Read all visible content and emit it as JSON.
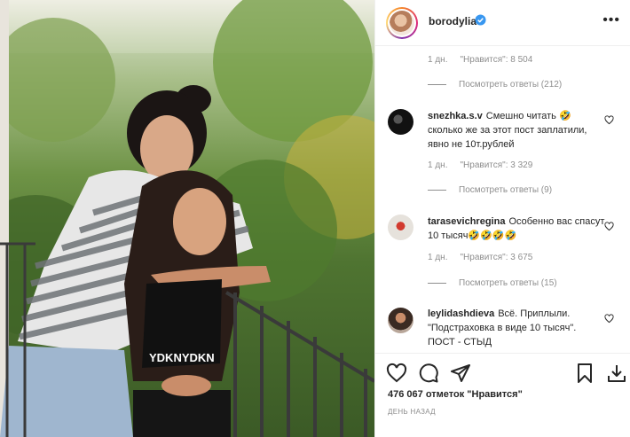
{
  "post": {
    "username": "borodylia",
    "more_glyph": "•••",
    "photo_shirt_text": "YDKNYDKN"
  },
  "comments": [
    {
      "meta_time": "1 дн.",
      "meta_likes": "\"Нравится\": 8 504",
      "replies": "Посмотреть ответы (212)"
    },
    {
      "user": "snezhka.s.v",
      "text": "Смешно читать 🤣 сколько же за этот пост заплатили, явно не 10т.рублей",
      "meta_time": "1 дн.",
      "meta_likes": "\"Нравится\": 3 329",
      "replies": "Посмотреть ответы (9)"
    },
    {
      "user": "tarasevichregina",
      "text": "Особенно вас спасут 10 тысяч🤣🤣🤣🤣",
      "meta_time": "1 дн.",
      "meta_likes": "\"Нравится\": 3 675",
      "replies": "Посмотреть ответы (15)"
    },
    {
      "user": "leylidashdieva",
      "text": "Всё. Приплыли. \"Подстраховка в виде 10 тысяч\". ПОСТ - СТЫД"
    }
  ],
  "footer": {
    "likes_total": "476 067 отметок \"Нравится\"",
    "time_ago": "ДЕНЬ НАЗАД"
  },
  "colors": {
    "verified": "#3897f0",
    "text": "#262626",
    "muted": "#8e8e8e"
  },
  "icons": {
    "like": "heart-icon",
    "comment": "comment-icon",
    "share": "paper-plane-icon",
    "save": "bookmark-icon",
    "download": "download-icon"
  }
}
